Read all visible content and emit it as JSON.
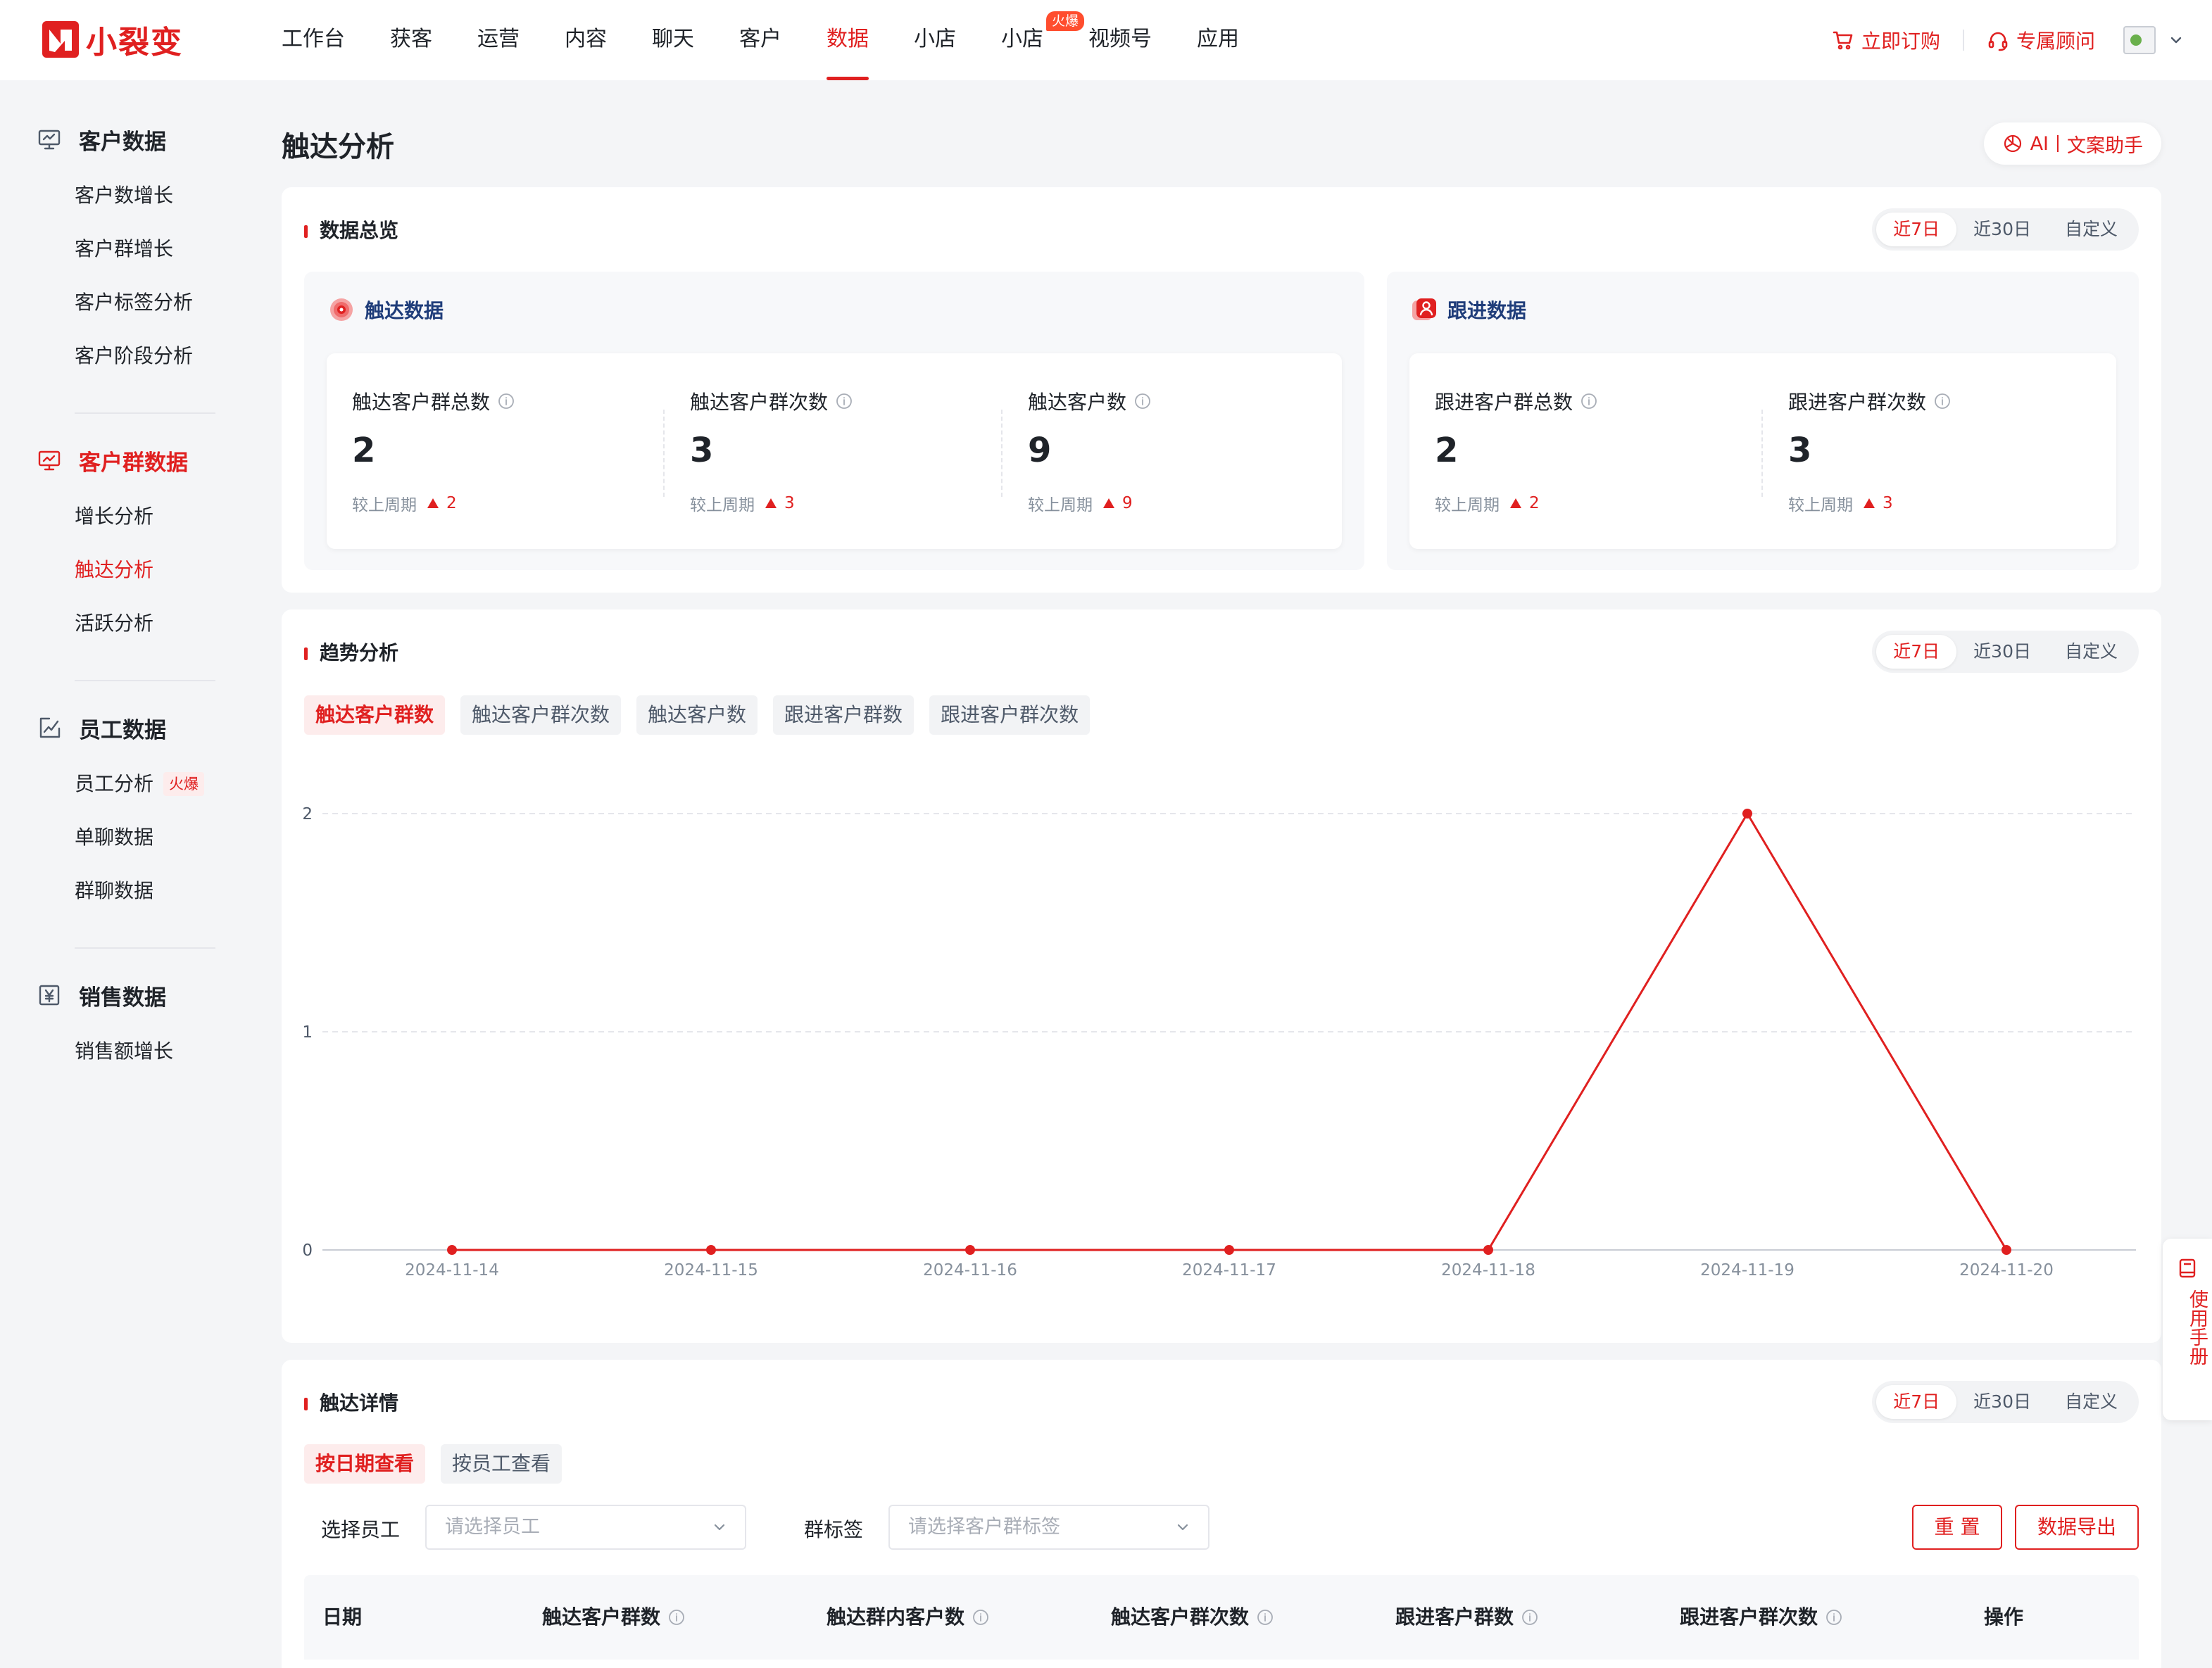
{
  "brand": {
    "name": "小裂变",
    "color": "#e02020"
  },
  "nav": {
    "items": [
      {
        "label": "工作台"
      },
      {
        "label": "获客"
      },
      {
        "label": "运营"
      },
      {
        "label": "内容"
      },
      {
        "label": "聊天"
      },
      {
        "label": "客户"
      },
      {
        "label": "数据",
        "active": true
      },
      {
        "label": "小店"
      },
      {
        "label": "小店",
        "badge": "火爆"
      },
      {
        "label": "视频号"
      },
      {
        "label": "应用"
      }
    ],
    "order_label": "立即订购",
    "consultant_label": "专属顾问"
  },
  "sidebar": {
    "groups": [
      {
        "title": "客户数据",
        "icon": "monitor-icon",
        "items": [
          "客户数增长",
          "客户群增长",
          "客户标签分析",
          "客户阶段分析"
        ]
      },
      {
        "title": "客户群数据",
        "icon": "monitor-chart-icon",
        "active": true,
        "items": [
          "增长分析",
          "触达分析",
          "活跃分析"
        ],
        "active_item": "触达分析"
      },
      {
        "title": "员工数据",
        "icon": "edit-chart-icon",
        "items": [
          "员工分析",
          "单聊数据",
          "群聊数据"
        ],
        "item_badge": "火爆"
      },
      {
        "title": "销售数据",
        "icon": "yen-icon",
        "items": [
          "销售额增长"
        ]
      }
    ]
  },
  "page": {
    "title": "触达分析",
    "ai_label": "AI",
    "ai_assist_label": "文案助手"
  },
  "overview": {
    "title": "数据总览",
    "range_options": [
      "近7日",
      "近30日",
      "自定义"
    ],
    "reach": {
      "title": "触达数据",
      "compare_label": "较上周期",
      "stats": [
        {
          "label": "触达客户群总数",
          "value": "2",
          "delta": "2"
        },
        {
          "label": "触达客户群次数",
          "value": "3",
          "delta": "3"
        },
        {
          "label": "触达客户数",
          "value": "9",
          "delta": "9"
        }
      ]
    },
    "follow": {
      "title": "跟进数据",
      "compare_label": "较上周期",
      "stats": [
        {
          "label": "跟进客户群总数",
          "value": "2",
          "delta": "2"
        },
        {
          "label": "跟进客户群次数",
          "value": "3",
          "delta": "3"
        }
      ]
    }
  },
  "trend": {
    "title": "趋势分析",
    "range_options": [
      "近7日",
      "近30日",
      "自定义"
    ],
    "tabs": [
      "触达客户群数",
      "触达客户群次数",
      "触达客户数",
      "跟进客户群数",
      "跟进客户群次数"
    ]
  },
  "chart_data": {
    "type": "line",
    "x": [
      "2024-11-14",
      "2024-11-15",
      "2024-11-16",
      "2024-11-17",
      "2024-11-18",
      "2024-11-19",
      "2024-11-20"
    ],
    "series": [
      {
        "values": [
          0,
          0,
          0,
          0,
          0,
          2,
          0
        ],
        "color": "#e02020"
      }
    ],
    "yticks": [
      "0",
      "1",
      "2"
    ],
    "ylim": [
      0,
      2
    ],
    "grid": true
  },
  "detail": {
    "title": "触达详情",
    "range_options": [
      "近7日",
      "近30日",
      "自定义"
    ],
    "tabs": [
      "按日期查看",
      "按员工查看"
    ],
    "filter_staff_label": "选择员工",
    "filter_staff_placeholder": "请选择员工",
    "filter_tag_label": "群标签",
    "filter_tag_placeholder": "请选择客户群标签",
    "reset_label": "重 置",
    "export_label": "数据导出",
    "columns": [
      "日期",
      "触达客户群数",
      "触达群内客户数",
      "触达客户群次数",
      "跟进客户群数",
      "跟进客户群次数",
      "操作"
    ]
  },
  "manual_label": "使用手册"
}
